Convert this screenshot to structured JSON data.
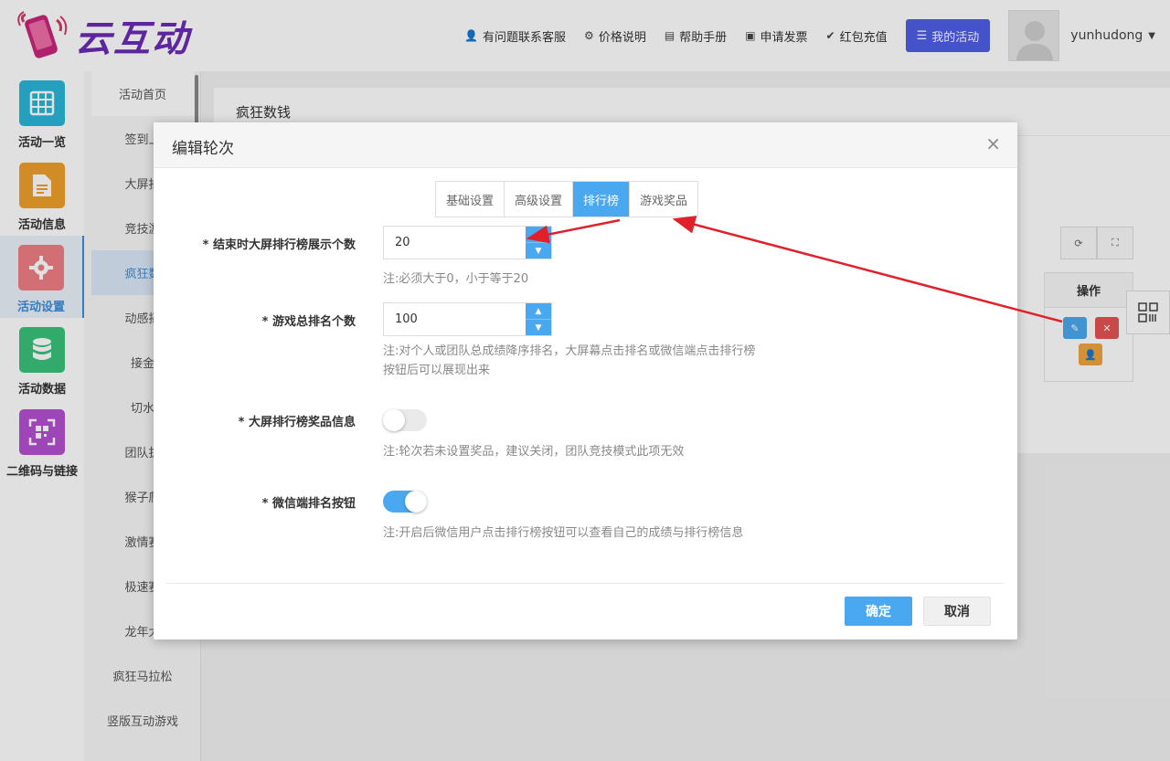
{
  "brand": {
    "name": "云互动"
  },
  "topnav": {
    "items": [
      {
        "icon": "person-plus-icon",
        "label": "有问题联系客服"
      },
      {
        "icon": "gear-icon",
        "label": "价格说明"
      },
      {
        "icon": "book-icon",
        "label": "帮助手册"
      },
      {
        "icon": "printer-icon",
        "label": "申请发票"
      },
      {
        "icon": "shield-check-icon",
        "label": "红包充值"
      }
    ],
    "my_activity": "我的活动",
    "username": "yunhudong"
  },
  "sidebar": {
    "items": [
      {
        "label": "活动一览",
        "color": "#29b6d9",
        "icon": "grid-icon"
      },
      {
        "label": "活动信息",
        "color": "#f0a02c",
        "icon": "document-icon"
      },
      {
        "label": "活动设置",
        "color": "#ef7f86",
        "icon": "gear-icon",
        "active": true
      },
      {
        "label": "活动数据",
        "color": "#39c27a",
        "icon": "database-icon"
      },
      {
        "label": "二维码与链接",
        "color": "#b44fd1",
        "icon": "qrcode-icon"
      }
    ]
  },
  "submenu": {
    "items": [
      "活动首页",
      "签到上",
      "大屏抽",
      "竞技游",
      "疯狂数",
      "动感摇",
      "接金",
      "切水",
      "团队拔",
      "猴子爬",
      "激情赛",
      "极速赛",
      "龙年大",
      "疯狂马拉松",
      "竖版互动游戏",
      "…"
    ]
  },
  "panel": {
    "title": "疯狂数钱",
    "op_header": "操作"
  },
  "modal": {
    "title": "编辑轮次",
    "close": "×",
    "tabs": [
      "基础设置",
      "高级设置",
      "排行榜",
      "游戏奖品"
    ],
    "active_tab": "排行榜",
    "fields": {
      "screen_count": {
        "label": "* 结束时大屏排行榜展示个数",
        "value": "20",
        "hint": "注:必须大于0，小于等于20"
      },
      "total_rank": {
        "label": "* 游戏总排名个数",
        "value": "100",
        "hint1": "注:对个人或团队总成绩降序排名，大屏幕点击排名或微信端点击排行榜",
        "hint2": "按钮后可以展现出来"
      },
      "prize_info": {
        "label": "* 大屏排行榜奖品信息",
        "state": "off",
        "hint": "注:轮次若未设置奖品，建议关闭，团队竞技模式此项无效"
      },
      "wechat_button": {
        "label": "* 微信端排名按钮",
        "state": "on",
        "hint": "注:开启后微信用户点击排行榜按钮可以查看自己的成绩与排行榜信息"
      }
    },
    "confirm": "确定",
    "cancel": "取消"
  },
  "colors": {
    "accent": "#4aa8f0",
    "primary": "#4e5fe6",
    "arrow": "#e0202a"
  }
}
